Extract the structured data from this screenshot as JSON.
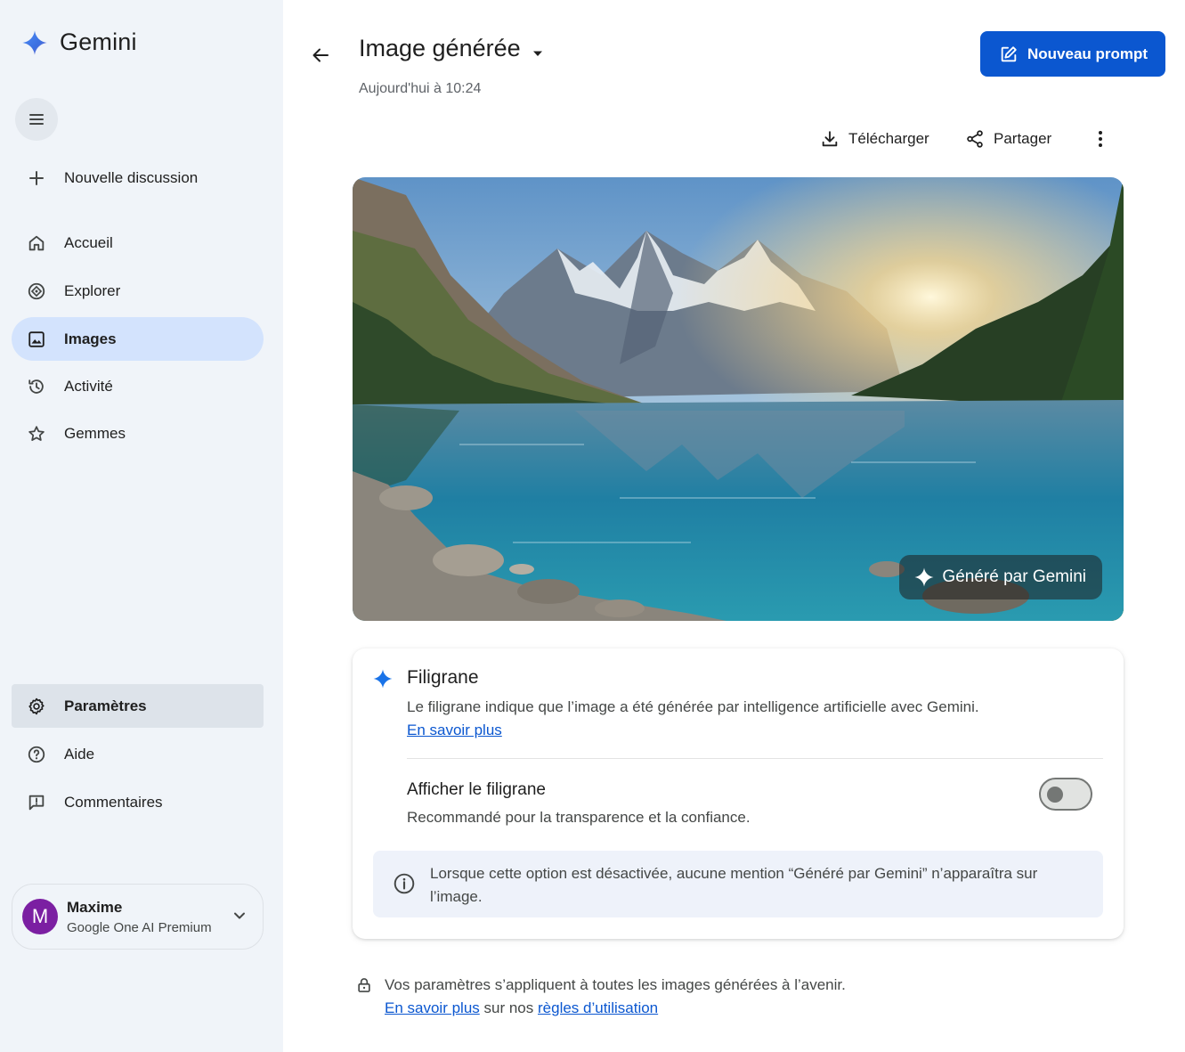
{
  "app": {
    "name": "Gemini"
  },
  "sidebar": {
    "new_chat": "Nouvelle discussion",
    "nav": [
      {
        "label": "Accueil",
        "icon": "home-icon"
      },
      {
        "label": "Explorer",
        "icon": "explore-icon"
      },
      {
        "label": "Images",
        "icon": "image-icon",
        "active": true
      },
      {
        "label": "Activité",
        "icon": "history-icon"
      },
      {
        "label": "Gemmes",
        "icon": "star-icon"
      }
    ],
    "bottom": [
      {
        "label": "Paramètres",
        "icon": "gear-icon",
        "active": true
      },
      {
        "label": "Aide",
        "icon": "help-icon"
      },
      {
        "label": "Commentaires",
        "icon": "feedback-icon"
      }
    ],
    "account": {
      "initial": "M",
      "name": "Maxime",
      "plan": "Google One AI Premium"
    }
  },
  "header": {
    "title": "Image générée",
    "timestamp": "Aujourd'hui à 10:24",
    "new_prompt": "Nouveau prompt"
  },
  "toolbar": {
    "download": "Télécharger",
    "share": "Partager"
  },
  "image": {
    "badge": "Généré par Gemini"
  },
  "watermark_card": {
    "title": "Filigrane",
    "description": "Le filigrane indique que l’image a été générée par intelligence artificielle avec Gemini.",
    "learn_more": "En savoir plus",
    "option_title": "Afficher le filigrane",
    "option_desc": "Recommandé pour la transparence et la confiance.",
    "toggle_on": false,
    "info": "Lorsque cette option est désactivée, aucune mention “Généré par Gemini” n’apparaîtra sur l’image."
  },
  "footer": {
    "line1": "Vos paramètres s’appliquent à toutes les images générées à l’avenir.",
    "link1": "En savoir plus",
    "mid": "sur nos",
    "link2": "règles d’utilisation"
  },
  "colors": {
    "accent": "#0b57d0",
    "sidebar_bg": "#f0f4f9",
    "active_nav": "#d3e3fd"
  }
}
